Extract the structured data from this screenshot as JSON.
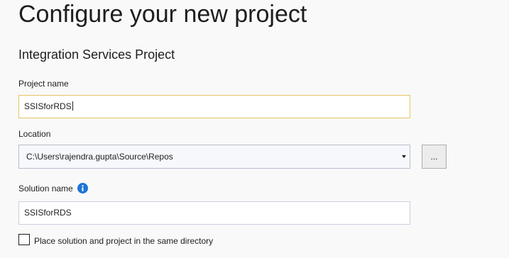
{
  "header": {
    "title": "Configure your new project",
    "project_type": "Integration Services Project"
  },
  "project_name": {
    "label": "Project name",
    "value": "SSISforRDS"
  },
  "location": {
    "label": "Location",
    "value": "C:\\Users\\rajendra.gupta\\Source\\Repos",
    "browse_label": "..."
  },
  "solution_name": {
    "label": "Solution name",
    "info_icon": "info-icon",
    "value": "SSISforRDS"
  },
  "same_directory": {
    "label": "Place solution and project in the same directory",
    "checked": false
  },
  "colors": {
    "focus_border": "#e5c365",
    "info_blue": "#1e74d6"
  }
}
